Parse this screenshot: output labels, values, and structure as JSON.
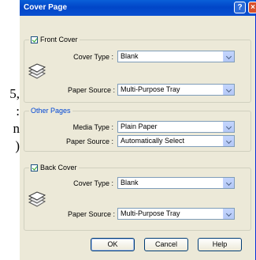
{
  "background_text": [
    "5,",
    ":",
    "n",
    ")"
  ],
  "dialog": {
    "title": "Cover Page",
    "help_button": "?",
    "close_button": "×"
  },
  "front_cover": {
    "label": "Front Cover",
    "checked": true,
    "cover_type_label": "Cover Type :",
    "cover_type_value": "Blank",
    "paper_source_label": "Paper Source :",
    "paper_source_value": "Multi-Purpose Tray",
    "icon": "paper-stack-icon"
  },
  "other_pages": {
    "label": "Other Pages",
    "media_type_label": "Media Type :",
    "media_type_value": "Plain Paper",
    "paper_source_label": "Paper Source :",
    "paper_source_value": "Automatically Select"
  },
  "back_cover": {
    "label": "Back Cover",
    "checked": true,
    "cover_type_label": "Cover Type :",
    "cover_type_value": "Blank",
    "paper_source_label": "Paper Source :",
    "paper_source_value": "Multi-Purpose Tray",
    "icon": "paper-stack-icon"
  },
  "buttons": {
    "ok": "OK",
    "cancel": "Cancel",
    "help": "Help"
  },
  "colors": {
    "titlebar": "#0046c8",
    "dialog_bg": "#ece9d8",
    "group_label": "#0046d5",
    "checkmark": "#21a121"
  }
}
